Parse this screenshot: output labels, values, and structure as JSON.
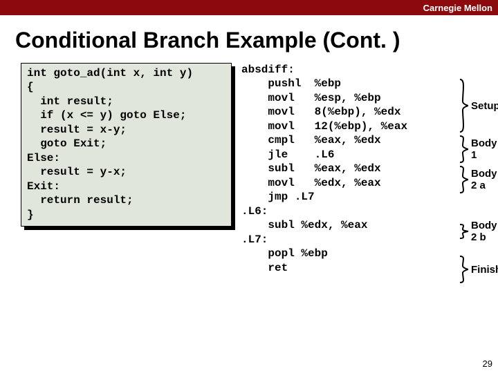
{
  "brand": "Carnegie Mellon",
  "title": "Conditional Branch Example (Cont. )",
  "c_code": "int goto_ad(int x, int y)\n{\n  int result;\n  if (x <= y) goto Else;\n  result = x-y;\n  goto Exit;\nElse:\n  result = y-x;\nExit:\n  return result;\n}",
  "asm": "absdiff:\n    pushl  %ebp\n    movl   %esp, %ebp\n    movl   8(%ebp), %edx\n    movl   12(%ebp), %eax\n    cmpl   %eax, %edx\n    jle    .L6\n    subl   %eax, %edx\n    movl   %edx, %eax\n    jmp .L7\n.L6:\n    subl %edx, %eax\n.L7:\n    popl %ebp\n    ret",
  "labels": {
    "setup": "Setup",
    "body1": "Body 1",
    "body2a": "Body 2 a",
    "body2b": "Body 2 b",
    "finish": "Finish"
  },
  "page_num": "29"
}
